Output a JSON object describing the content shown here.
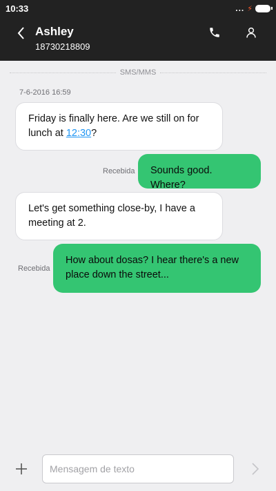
{
  "status_bar": {
    "time": "10:33",
    "dots": "..."
  },
  "header": {
    "contact_name": "Ashley",
    "contact_number": "18730218809"
  },
  "thread": {
    "channel_label": "SMS/MMS",
    "date": "7-6-2016 16:59",
    "messages": [
      {
        "direction": "incoming",
        "text_before": "Friday is finally here. Are we still on for lunch at ",
        "link": "12:30",
        "text_after": "?"
      },
      {
        "direction": "outgoing",
        "text": "Sounds good. Where?",
        "status": "Recebida"
      },
      {
        "direction": "incoming",
        "text": "Let's get something close-by, I have a meeting at 2."
      },
      {
        "direction": "outgoing",
        "text": "How about dosas? I hear there's a new place down the street...",
        "status": "Recebida"
      }
    ]
  },
  "composer": {
    "placeholder": "Mensagem de texto",
    "value": ""
  },
  "colors": {
    "header_bg": "#222222",
    "outgoing_bubble": "#34c572",
    "incoming_bubble": "#ffffff",
    "link": "#2196f3",
    "background": "#efeff1"
  }
}
